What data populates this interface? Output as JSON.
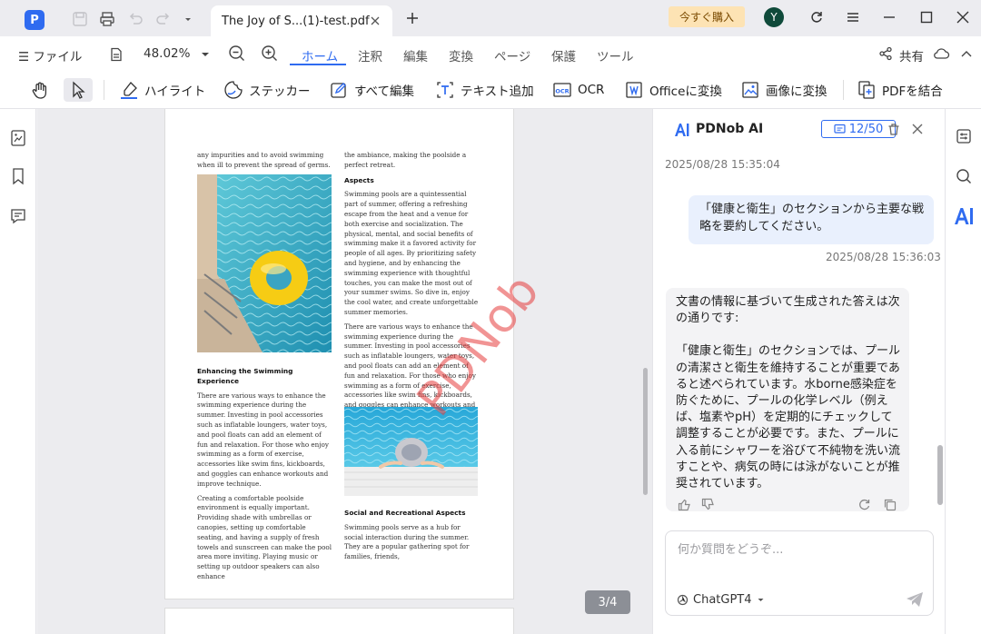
{
  "titlebar": {
    "tab_title": "The Joy of S...(1)-test.pdf",
    "buy_label": "今すぐ購入",
    "avatar_initial": "Y"
  },
  "menubar": {
    "file_label": "ファイル",
    "zoom": "48.02%",
    "tabs": [
      "ホーム",
      "注釈",
      "編集",
      "変換",
      "ページ",
      "保護",
      "ツール"
    ],
    "active_tab": "ホーム",
    "share_label": "共有"
  },
  "toolbar": {
    "highlight": "ハイライト",
    "sticker": "ステッカー",
    "edit_all": "すべて編集",
    "add_text": "テキスト追加",
    "ocr": "OCR",
    "to_office": "Officeに変換",
    "to_image": "画像に変換",
    "merge_pdf": "PDFを結合"
  },
  "document": {
    "left_col": {
      "p1": "any impurities and to avoid swimming when ill to prevent the spread of germs.",
      "h1": "Enhancing the Swimming Experience",
      "p2": "There are various ways to enhance the swimming experience during the summer. Investing in pool accessories such as inflatable loungers, water toys, and pool floats can add an element of fun and relaxation. For those who enjoy swimming as a form of exercise, accessories like swim fins, kickboards, and goggles can enhance workouts and improve technique.",
      "p3": "Creating a comfortable poolside environment is equally important. Providing shade with umbrellas or canopies, setting up comfortable seating, and having a supply of fresh towels and sunscreen can make the pool area more inviting. Playing music or setting up outdoor speakers can also enhance"
    },
    "right_col": {
      "p1": "the ambiance, making the poolside a perfect retreat.",
      "h1": "Aspects",
      "p2": "Swimming pools are a quintessential part of summer, offering a refreshing escape from the heat and a venue for both exercise and socialization. The physical, mental, and social benefits of swimming make it a favored activity for people of all ages. By prioritizing safety and hygiene, and by enhancing the swimming experience with thoughtful touches, you can make the most out of your summer swims. So dive in, enjoy the cool water, and create unforgettable summer memories.",
      "p3": "There are various ways to enhance the swimming experience during the summer. Investing in pool accessories such as inflatable loungers, water toys, and pool floats can add an element of fun and relaxation. For those who enjoy swimming as a form of exercise, accessories like swim fins, kickboards, and goggles can enhance workouts and improve technique.",
      "h2": "Social and Recreational Aspects",
      "p4": "Swimming pools serve as a hub for social interaction during the summer. They are a popular gathering spot for families, friends,"
    },
    "watermark": "PDNob",
    "page_indicator": "3/4"
  },
  "ai_panel": {
    "title": "PDNob AI",
    "quota": "12/50",
    "ts1": "2025/08/28 15:35:04",
    "user_msg": "「健康と衛生」のセクションから主要な戦略を要約してください。",
    "ts2": "2025/08/28 15:36:03",
    "ai_intro": "文書の情報に基づいて生成された答えは次の通りです:",
    "ai_answer": "「健康と衛生」のセクションでは、プールの清潔さと衛生を維持することが重要であると述べられています。水borne感染症を防ぐために、プールの化学レベル（例えば、塩素やpH）を定期的にチェックして調整することが必要です。また、プールに入る前にシャワーを浴びて不純物を洗い流すことや、病気の時には泳がないことが推奨されています。",
    "input_placeholder": "何か質問をどうぞ...",
    "model": "ChatGPT4"
  },
  "colors": {
    "accent": "#2f6bf0",
    "buy_bg": "#fde3b4",
    "watermark": "#e63c3c"
  }
}
